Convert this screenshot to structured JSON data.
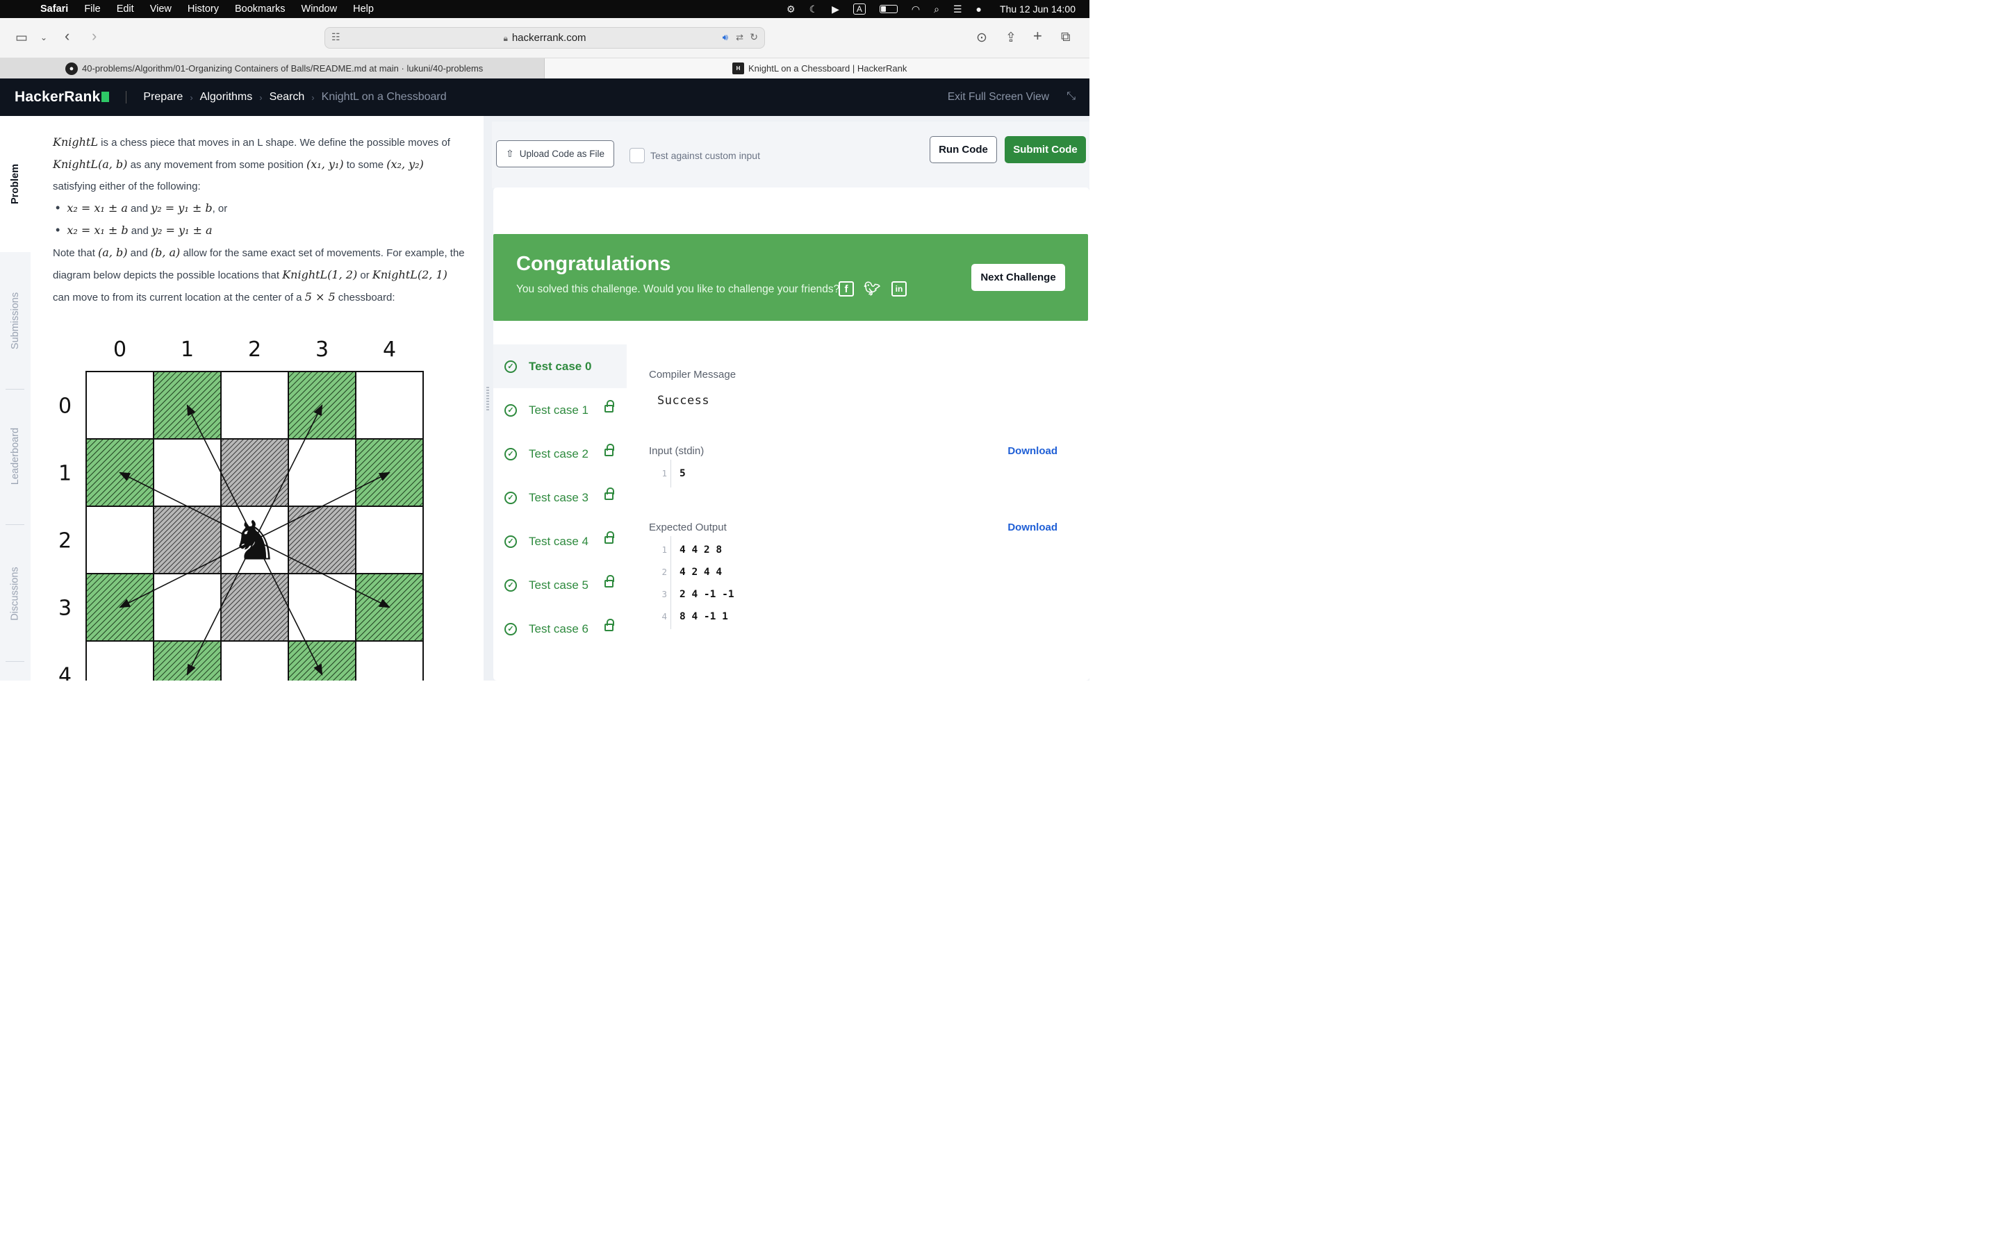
{
  "menubar": {
    "app": "Safari",
    "items": [
      "File",
      "Edit",
      "View",
      "History",
      "Bookmarks",
      "Window",
      "Help"
    ],
    "clock": "Thu 12 Jun  14:00"
  },
  "toolbar": {
    "url": "hackerrank.com"
  },
  "tabs": [
    {
      "title": "40-problems/Algorithm/01-Organizing Containers of Balls/README.md at main · lukuni/40-problems",
      "close": "×"
    },
    {
      "title": "KnightL on a Chessboard | HackerRank"
    }
  ],
  "header": {
    "logo": "HackerRank",
    "breadcrumbs": [
      "Prepare",
      "Algorithms",
      "Search",
      "KnightL on a Chessboard"
    ],
    "exit_full_screen": "Exit Full Screen View"
  },
  "side_tabs": [
    "Problem",
    "Submissions",
    "Leaderboard",
    "Discussions"
  ],
  "problem": {
    "p1a": "KnightL",
    "p1b": " is a chess piece that moves in an ",
    "p1c": "L",
    "p1d": " shape. We define the possible moves of",
    "p2a": "KnightL(a, b)",
    "p2b": " as any movement from some position ",
    "p2c": "(x₁, y₁)",
    "p2d": " to some ",
    "p2e": "(x₂, y₂)",
    "p3": "satisfying either of the following:",
    "b1a": "x₂ = x₁ ± a",
    "b1b": " and ",
    "b1c": "y₂ = y₁ ± b",
    "b1d": ", or",
    "b2a": "x₂ = x₁ ± b",
    "b2b": " and ",
    "b2c": "y₂ = y₁ ± a",
    "n1a": "Note that ",
    "n1b": "(a, b)",
    "n1c": " and ",
    "n1d": "(b, a)",
    "n1e": " allow for the same exact set of movements. For example, the",
    "n2a": "diagram below depicts the possible locations that ",
    "n2b": "KnightL(1, 2)",
    "n2c": " or ",
    "n2d": "KnightL(2, 1)",
    "n3a": "can move to from its current location at the center of a ",
    "n3b": "5 × 5",
    "n3c": " chessboard:"
  },
  "board": {
    "col_labels": [
      "0",
      "1",
      "2",
      "3",
      "4"
    ],
    "row_labels": [
      "0",
      "1",
      "2",
      "3",
      "4"
    ],
    "piece": "♞",
    "green_cells": [
      [
        0,
        1
      ],
      [
        0,
        3
      ],
      [
        1,
        0
      ],
      [
        1,
        4
      ],
      [
        3,
        0
      ],
      [
        3,
        4
      ],
      [
        4,
        1
      ],
      [
        4,
        3
      ]
    ],
    "gray_cells": [
      [
        1,
        2
      ],
      [
        2,
        1
      ],
      [
        2,
        3
      ],
      [
        3,
        2
      ]
    ],
    "knight_cell": [
      2,
      2
    ],
    "colors": {
      "green": "#7fc77f",
      "gray": "#9a9a9a"
    }
  },
  "editor": {
    "upload": "Upload Code as File",
    "custom_input": "Test against custom input",
    "run": "Run Code",
    "submit": "Submit Code"
  },
  "result": {
    "title": "Congratulations",
    "subtitle": "You solved this challenge. Would you like to challenge your friends?",
    "next": "Next Challenge"
  },
  "testcases": [
    "Test case 0",
    "Test case 1",
    "Test case 2",
    "Test case 3",
    "Test case 4",
    "Test case 5",
    "Test case 6"
  ],
  "detail": {
    "compiler_label": "Compiler Message",
    "compiler_msg": "Success",
    "input_label": "Input (stdin)",
    "download": "Download",
    "input_lines": [
      "5"
    ],
    "expected_label": "Expected Output",
    "expected_lines": [
      "4 4 2 8",
      "4 2 4 4",
      "2 4 -1 -1",
      "8 4 -1 1"
    ]
  }
}
